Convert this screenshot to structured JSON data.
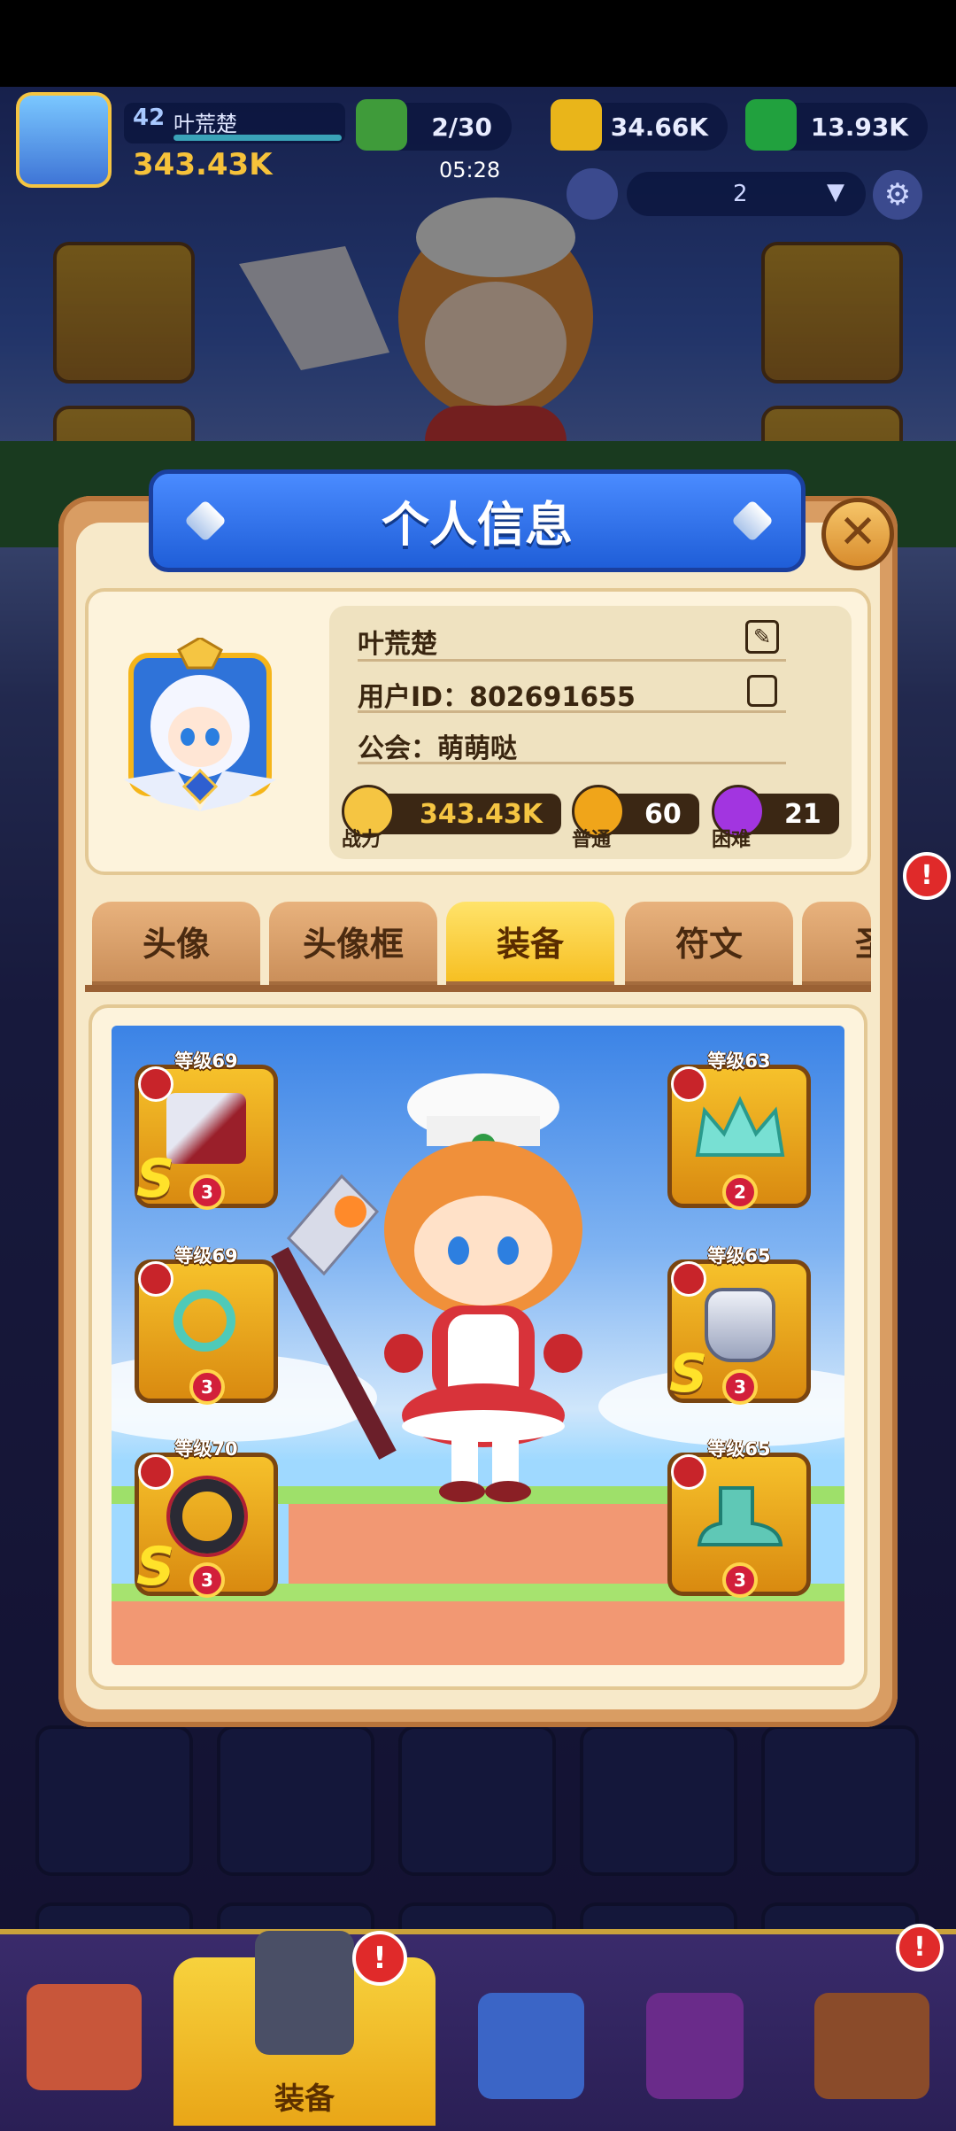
{
  "hud": {
    "level": "42",
    "name": "叶荒楚",
    "power": "343.43K",
    "energy": "2/30",
    "gold": "34.66K",
    "gems": "13.93K",
    "timer": "05:28",
    "selector_value": "2"
  },
  "modal": {
    "title": "个人信息",
    "close_icon": "close-icon"
  },
  "profile": {
    "name": "叶荒楚",
    "user_id": "用户ID：802691655",
    "guild": "公会：萌萌哒",
    "stats": {
      "power_value": "343.43K",
      "power_label": "战力",
      "normal_value": "60",
      "normal_label": "普通",
      "hard_value": "21",
      "hard_label": "困难"
    }
  },
  "tabs": [
    {
      "label": "头像",
      "active": false
    },
    {
      "label": "头像框",
      "active": false
    },
    {
      "label": "装备",
      "active": true
    },
    {
      "label": "符文",
      "active": false
    },
    {
      "label": "圣",
      "active": false
    }
  ],
  "equipment": {
    "left": [
      {
        "level": "等级69",
        "type_icon": "weapon-icon",
        "s_rank": "S",
        "stars": "3",
        "item_icon": "axe-icon"
      },
      {
        "level": "等级69",
        "type_icon": "necklace-icon",
        "s_rank": "",
        "stars": "3",
        "item_icon": "necklace-icon"
      },
      {
        "level": "等级70",
        "type_icon": "ring-icon",
        "s_rank": "S",
        "stars": "3",
        "item_icon": "ring-icon"
      }
    ],
    "right": [
      {
        "level": "等级63",
        "type_icon": "helmet-icon",
        "s_rank": "",
        "stars": "2",
        "item_icon": "crown-icon"
      },
      {
        "level": "等级65",
        "type_icon": "armor-icon",
        "s_rank": "S",
        "stars": "3",
        "item_icon": "armor-icon"
      },
      {
        "level": "等级65",
        "type_icon": "boots-icon",
        "s_rank": "",
        "stars": "3",
        "item_icon": "boots-icon"
      }
    ]
  },
  "bottom_nav": {
    "active_label": "装备",
    "badge": "!"
  },
  "colors": {
    "banner_blue": "#2f6ee8",
    "modal_bg": "#f7e9c9",
    "gold": "#f6bd1e",
    "power_text": "#f5c542"
  }
}
